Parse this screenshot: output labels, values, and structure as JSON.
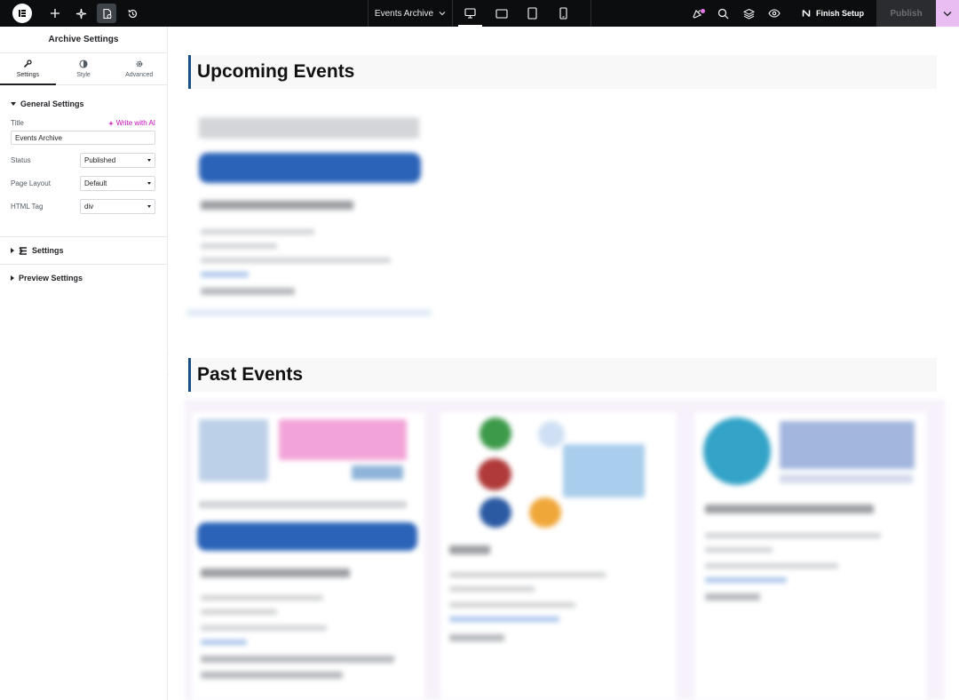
{
  "topbar": {
    "document_title": "Events Archive",
    "finish_setup_label": "Finish Setup",
    "publish_label": "Publish",
    "left_icons": [
      "elementor-logo-icon",
      "add-icon",
      "ai-sparkle-icon",
      "page-settings-icon",
      "history-icon"
    ],
    "device_icons": [
      "desktop-icon",
      "tablet-landscape-icon",
      "tablet-icon",
      "mobile-icon"
    ],
    "right_icons": [
      "notifications-icon",
      "search-icon",
      "structure-layers-icon",
      "preview-eye-icon"
    ]
  },
  "panel": {
    "title": "Archive Settings",
    "tabs": [
      {
        "label": "Settings",
        "icon": "wrench-icon",
        "active": true
      },
      {
        "label": "Style",
        "icon": "half-circle-icon",
        "active": false
      },
      {
        "label": "Advanced",
        "icon": "gear-icon",
        "active": false
      }
    ],
    "general": {
      "label": "General Settings",
      "title_label": "Title",
      "ai_label": "Write with AI",
      "title_value": "Events Archive",
      "fields": [
        {
          "label": "Status",
          "value": "Published"
        },
        {
          "label": "Page Layout",
          "value": "Default"
        },
        {
          "label": "HTML Tag",
          "value": "div"
        }
      ]
    },
    "collapsed_sections": [
      {
        "label": "Settings",
        "icon": "elementor-e-icon"
      },
      {
        "label": "Preview Settings",
        "icon": ""
      }
    ]
  },
  "canvas": {
    "upcoming_heading": "Upcoming Events",
    "past_heading": "Past Events"
  },
  "colors": {
    "topbar_bg": "#0c0d0e",
    "accent_pink": "#c00bb9",
    "heading_border": "#1a4f86",
    "publish_more_bg": "#e9bdf2"
  }
}
